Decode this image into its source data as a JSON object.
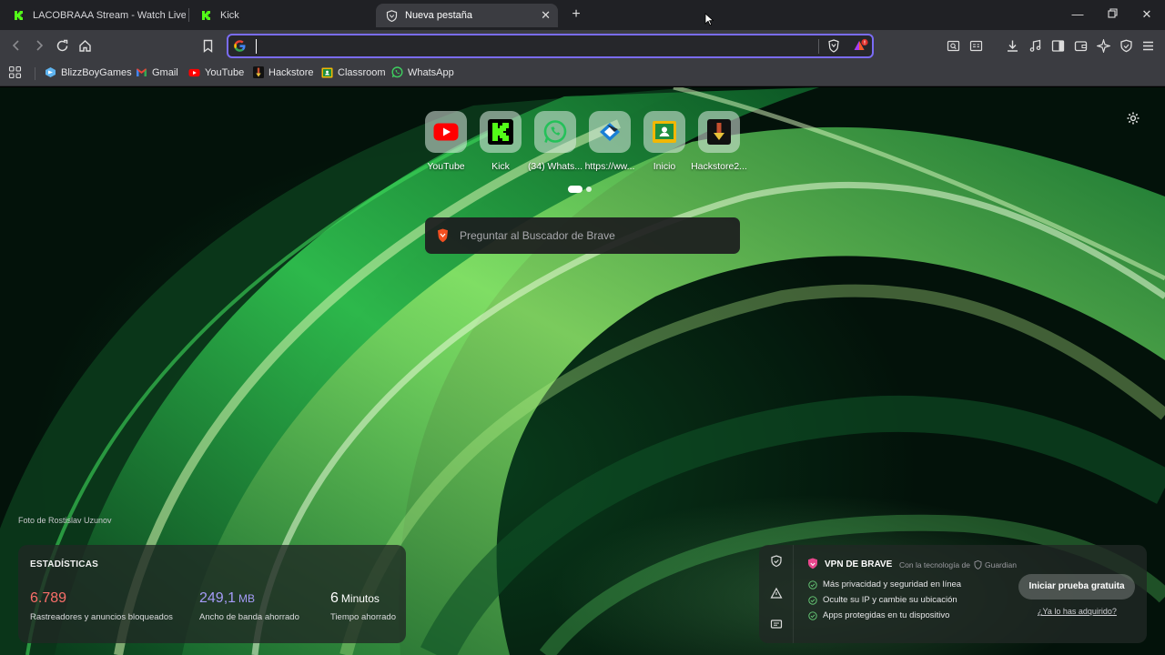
{
  "tabs": [
    {
      "title": "LACOBRAAA Stream - Watch Live on",
      "icon": "kick-icon"
    },
    {
      "title": "Kick",
      "icon": "kick-icon"
    },
    {
      "title": "Nueva pestaña",
      "icon": "brave-shield-icon",
      "active": true
    }
  ],
  "omnibox": {
    "value": "",
    "placeholder": ""
  },
  "bookmarks": [
    {
      "label": "BlizzBoyGames",
      "icon": "blizzboy-icon"
    },
    {
      "label": "Gmail",
      "icon": "gmail-icon"
    },
    {
      "label": "YouTube",
      "icon": "youtube-icon"
    },
    {
      "label": "Hackstore",
      "icon": "hackstore-icon"
    },
    {
      "label": "Classroom",
      "icon": "classroom-icon"
    },
    {
      "label": "WhatsApp",
      "icon": "whatsapp-icon"
    }
  ],
  "topsites": [
    {
      "label": "YouTube"
    },
    {
      "label": "Kick"
    },
    {
      "label": "(34) Whats..."
    },
    {
      "label": "https://ww..."
    },
    {
      "label": "Inicio"
    },
    {
      "label": "Hackstore2..."
    }
  ],
  "search": {
    "placeholder": "Preguntar al Buscador de Brave"
  },
  "photo_credit": "Foto de Rostislav Uzunov",
  "stats": {
    "title": "ESTADÍSTICAS",
    "trackers": {
      "value": "6.789",
      "label": "Rastreadores y anuncios bloqueados",
      "color": "#fb6f6a"
    },
    "bandwidth": {
      "value": "249,1",
      "unit": "MB",
      "label": "Ancho de banda ahorrado",
      "color": "#a59bf7"
    },
    "time": {
      "value": "6",
      "unit": "Minutos",
      "label": "Tiempo ahorrado",
      "color": "#ffffff"
    }
  },
  "vpn": {
    "title": "VPN DE BRAVE",
    "subtitle": "Con la tecnología de",
    "partner": "Guardian",
    "features": [
      "Más privacidad y seguridad en línea",
      "Oculte su IP y cambie su ubicación",
      "Apps protegidas en tu dispositivo"
    ],
    "cta": "Iniciar prueba gratuita",
    "link": "¿Ya lo has adquirido?"
  },
  "colors": {
    "accent": "#7a6cf5",
    "tab_active": "#3b3c41",
    "tabbar": "#202125"
  }
}
